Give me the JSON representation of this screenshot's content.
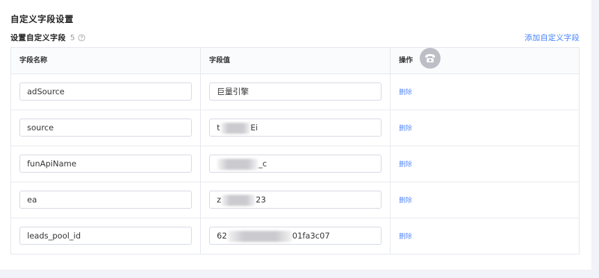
{
  "section_title": "自定义字段设置",
  "sub_header": {
    "title": "设置自定义字段",
    "count": "5"
  },
  "add_link": "添加自定义字段",
  "table": {
    "columns": [
      "字段名称",
      "字段值",
      "操作"
    ],
    "delete_label": "删除",
    "rows": [
      {
        "name": "adSource",
        "value_visible_start": "巨量引擎",
        "value_visible_end": ""
      },
      {
        "name": "source",
        "value_visible_start": "t",
        "value_visible_end": "Ei"
      },
      {
        "name": "funApiName",
        "value_visible_start": "",
        "value_visible_end": "_c"
      },
      {
        "name": "ea",
        "value_visible_start": "z",
        "value_visible_end": "23"
      },
      {
        "name": "leads_pool_id",
        "value_visible_start": "62",
        "value_visible_end": "01fa3c07"
      }
    ]
  },
  "colors": {
    "link": "#407fff",
    "border": "#e4e7ee",
    "page_bg": "#f1f3f8"
  },
  "icons": [
    "help-circle-icon",
    "phone-icon"
  ]
}
